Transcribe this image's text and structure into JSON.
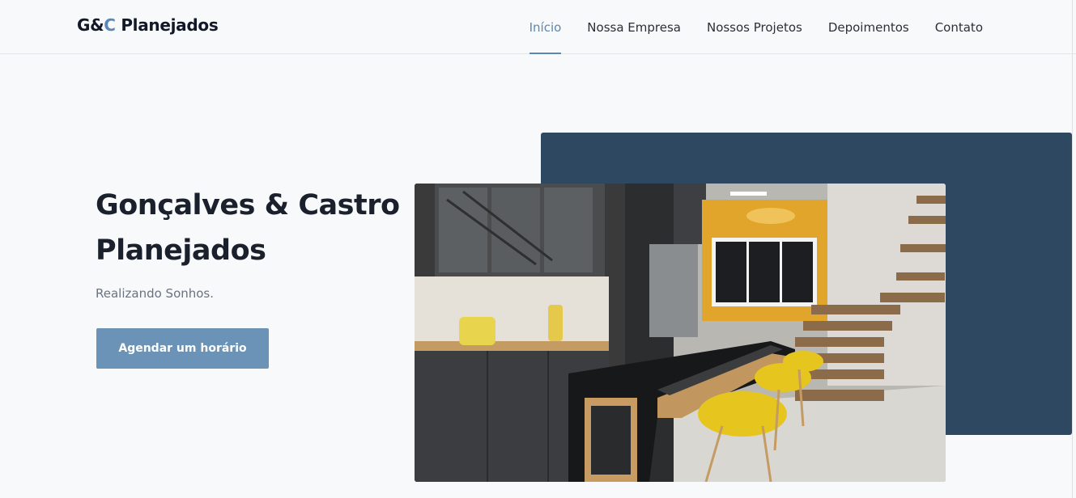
{
  "navbar": {
    "brand_part1": "G&",
    "brand_accent": "C",
    "brand_part2": " Planejados",
    "links": [
      "Início",
      "Nossa Empresa",
      "Nossos Projetos",
      "Depoimentos",
      "Contato"
    ],
    "active_link": "Início"
  },
  "hero": {
    "title": "Gonçalves & Castro Planejados",
    "subtitle": "Realizando Sonhos.",
    "cta_label": "Agendar um horário",
    "image_subject": "kitchen-photo"
  },
  "colors": {
    "accent": "#5b87b5",
    "button": "#6b93b8",
    "panel": "#2e4862",
    "text_dark": "#1a202c"
  }
}
